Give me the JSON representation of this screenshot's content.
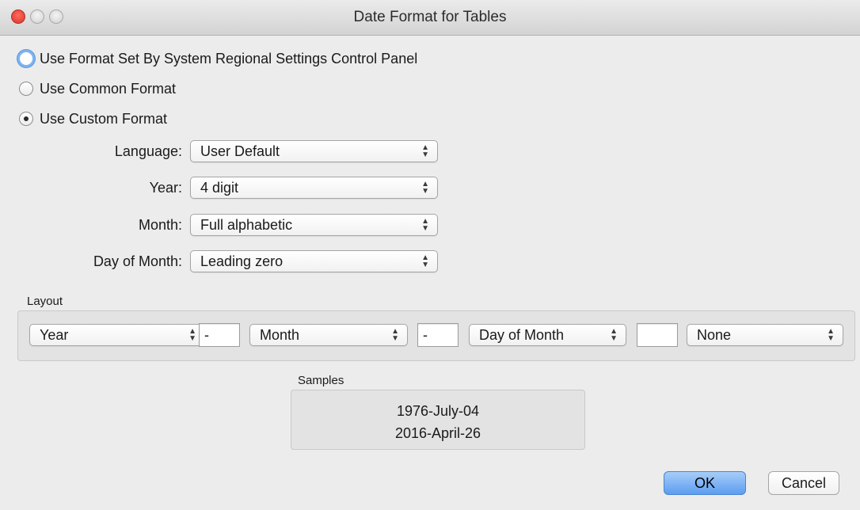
{
  "window": {
    "title": "Date Format for Tables"
  },
  "format_options": [
    {
      "label": "Use Format Set By System Regional Settings Control Panel",
      "selected": false,
      "focused": true
    },
    {
      "label": "Use Common Format",
      "selected": false,
      "focused": false
    },
    {
      "label": "Use Custom Format",
      "selected": true,
      "focused": false
    }
  ],
  "custom": {
    "language_label": "Language:",
    "language_value": "User Default",
    "year_label": "Year:",
    "year_value": "4 digit",
    "month_label": "Month:",
    "month_value": "Full alphabetic",
    "day_label": "Day of Month:",
    "day_value": "Leading zero"
  },
  "layout": {
    "label": "Layout",
    "part1": "Year",
    "sep1": "-",
    "part2": "Month",
    "sep2": "-",
    "part3": "Day of Month",
    "sep3": "",
    "part4": "None"
  },
  "samples": {
    "label": "Samples",
    "lines": [
      "1976-July-04",
      "2016-April-26"
    ]
  },
  "buttons": {
    "ok": "OK",
    "cancel": "Cancel"
  },
  "colors": {
    "accent": "#5c9df0",
    "close": "#d9352b"
  }
}
